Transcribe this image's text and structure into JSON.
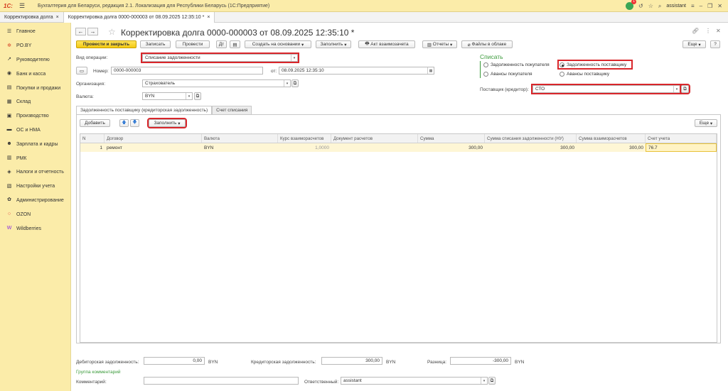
{
  "titlebar": {
    "logo": "1С:",
    "app_title": "Бухгалтерия для Беларуси, редакция 2.1. Локализация для Республики Беларусь   (1С:Предприятие)",
    "notif_count": "1",
    "user": "assistant"
  },
  "tabs": [
    {
      "label": "Корректировка долга",
      "close": "×"
    },
    {
      "label": "Корректировка долга 0000-000003 от 08.09.2025 12:35:10 *",
      "close": "×"
    }
  ],
  "sidebar": {
    "items": [
      {
        "label": "Главное",
        "icon": "menu-icon",
        "glyph": "☰"
      },
      {
        "label": "PO.BY",
        "icon": "star-icon",
        "glyph": "✲"
      },
      {
        "label": "Руководителю",
        "icon": "chart-icon",
        "glyph": "↗"
      },
      {
        "label": "Банк и касса",
        "icon": "bank-icon",
        "glyph": "◉"
      },
      {
        "label": "Покупки и продажи",
        "icon": "cart-icon",
        "glyph": "▤"
      },
      {
        "label": "Склад",
        "icon": "warehouse-icon",
        "glyph": "▦"
      },
      {
        "label": "Производство",
        "icon": "factory-icon",
        "glyph": "▣"
      },
      {
        "label": "ОС и НМА",
        "icon": "assets-icon",
        "glyph": "▬"
      },
      {
        "label": "Зарплата и кадры",
        "icon": "people-icon",
        "glyph": "☻"
      },
      {
        "label": "РМК",
        "icon": "cashier-icon",
        "glyph": "▥"
      },
      {
        "label": "Налоги и отчетность",
        "icon": "tax-icon",
        "glyph": "◈"
      },
      {
        "label": "Настройки учета",
        "icon": "settings-doc-icon",
        "glyph": "▧"
      },
      {
        "label": "Администрирование",
        "icon": "gear-icon",
        "glyph": "✿"
      },
      {
        "label": "OZON",
        "icon": "ozon-icon",
        "glyph": "○"
      },
      {
        "label": "Wildberries",
        "icon": "wildberries-icon",
        "glyph": "W"
      }
    ]
  },
  "doc": {
    "title": "Корректировка долга 0000-000003 от 08.09.2025 12:35:10 *"
  },
  "toolbar": {
    "post_close": "Провести и закрыть",
    "save": "Записать",
    "post": "Провести",
    "create_based": "Создать на основании",
    "fill": "Заполнить",
    "act": "Акт взаимозачета",
    "reports": "Отчеты",
    "files": "Файлы в облаке",
    "more": "Еще",
    "help": "?"
  },
  "form": {
    "op_label": "Вид операции:",
    "op_value": "Списание задолженности",
    "num_label": "Номер:",
    "num_value": "0000-000003",
    "date_label": "от:",
    "date_value": "08.09.2025 12:35:10",
    "org_label": "Организация:",
    "org_value": "Страхователь",
    "cur_label": "Валюта:",
    "cur_value": "BYN",
    "writeoff_title": "Списать",
    "opt1": "Задолженность покупателя",
    "opt2": "Задолженность поставщику",
    "opt3": "Авансы покупателя",
    "opt4": "Авансы поставщику",
    "supplier_label": "Поставщик (кредитор):",
    "supplier_value": "СТО"
  },
  "inner_tabs": [
    "Задолженность поставщику (кредиторская задолженность)",
    "Счет списания"
  ],
  "table_toolbar": {
    "add": "Добавить",
    "fill": "Заполнить",
    "more": "Еще"
  },
  "table": {
    "headers": [
      "N",
      "Договор",
      "Валюта",
      "Курс взаиморасчетов",
      "Документ расчетов",
      "Сумма",
      "Сумма списания задолженности (НУ)",
      "Сумма взаиморасчетов",
      "Счет учета"
    ],
    "rows": [
      [
        "1",
        "ремонт",
        "BYN",
        "1,0000",
        "",
        "300,00",
        "300,00",
        "300,00",
        "76.7"
      ]
    ]
  },
  "footer": {
    "debit_label": "Дебиторская задолженность:",
    "debit_value": "0,00",
    "debit_cur": "BYN",
    "credit_label": "Кредиторская задолженность:",
    "credit_value": "300,00",
    "credit_cur": "BYN",
    "diff_label": "Разница:",
    "diff_value": "-300,00",
    "diff_cur": "BYN",
    "comment_group": "Группа комментарий",
    "comment_label": "Комментарий:",
    "comment_value": "",
    "resp_label": "Ответственный:",
    "resp_value": "assistant"
  }
}
